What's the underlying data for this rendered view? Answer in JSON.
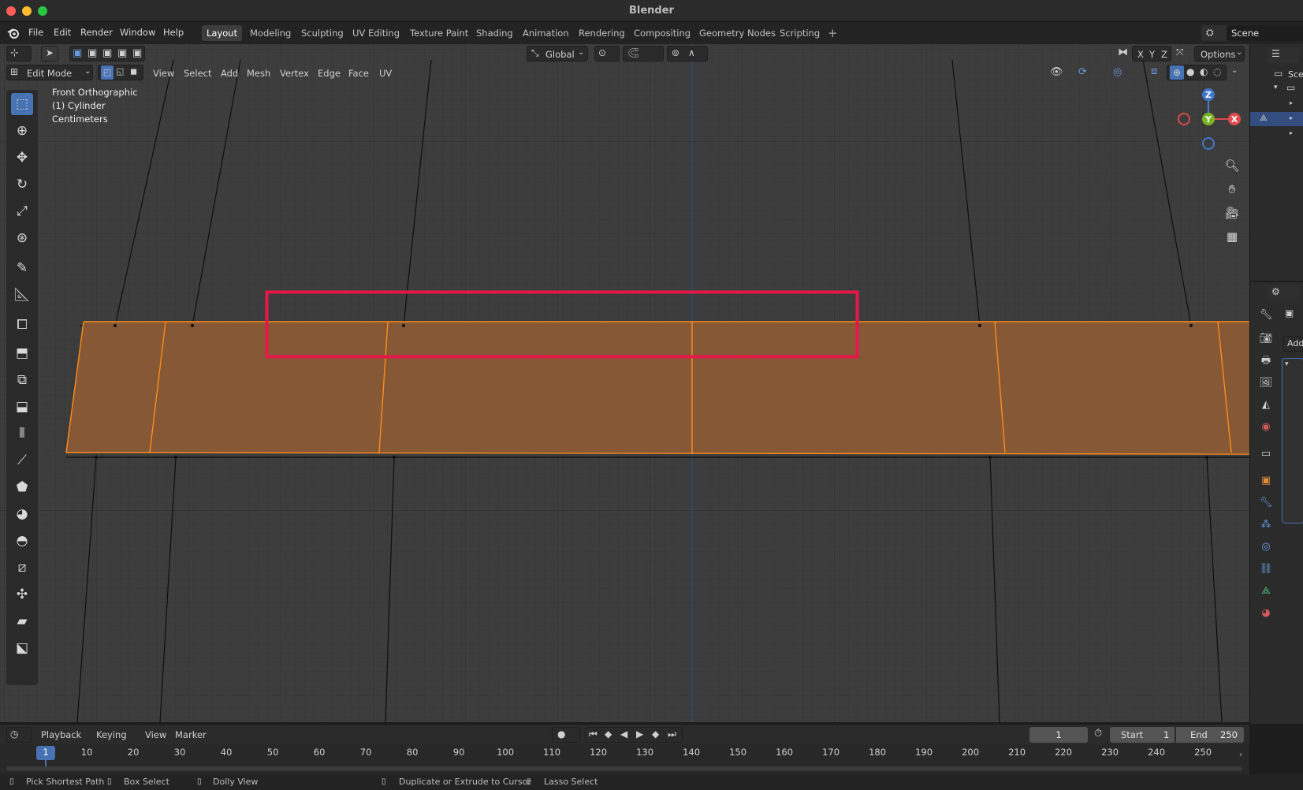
{
  "window": {
    "title": "Blender"
  },
  "menu": {
    "items": [
      "File",
      "Edit",
      "Render",
      "Window",
      "Help"
    ],
    "workspaces": [
      "Layout",
      "Modeling",
      "Sculpting",
      "UV Editing",
      "Texture Paint",
      "Shading",
      "Animation",
      "Rendering",
      "Compositing",
      "Geometry Nodes",
      "Scripting"
    ],
    "active_workspace": "Layout",
    "add_tab_icon": "plus-icon",
    "scene_label": "Scene"
  },
  "viewport_header": {
    "transform_orientation": "Global",
    "axes": [
      "X",
      "Y",
      "Z"
    ],
    "options_label": "Options",
    "mode": "Edit Mode",
    "menus": [
      "View",
      "Select",
      "Add",
      "Mesh",
      "Vertex",
      "Edge",
      "Face",
      "UV"
    ]
  },
  "viewport_overlay": {
    "view_name": "Front Orthographic",
    "object_name": "(1) Cylinder",
    "units": "Centimeters"
  },
  "gizmo": {
    "z": "Z",
    "y": "Y",
    "x": "X"
  },
  "highlight": {
    "color": "#e8174a"
  },
  "colors": {
    "selection": "#ff8c1a",
    "active_tool": "#4772b3",
    "viewport_bg": "#3d3d3d"
  },
  "toolbar": {
    "tools": [
      "select-box-icon",
      "cursor-icon",
      "move-icon",
      "rotate-icon",
      "scale-icon",
      "transform-icon",
      "annotate-icon",
      "measure-icon",
      "add-cube-icon",
      "extrude-icon",
      "inset-icon",
      "bevel-icon",
      "loop-cut-icon",
      "knife-icon",
      "poly-build-icon",
      "spin-icon",
      "smooth-icon",
      "edge-slide-icon",
      "shrink-fatten-icon",
      "shear-icon",
      "rip-icon"
    ]
  },
  "outliner": {
    "scene_label": "Scen"
  },
  "properties": {
    "add_label": "Add"
  },
  "timeline": {
    "menus": [
      "Playback",
      "Keying",
      "View",
      "Marker"
    ],
    "current_frame": "1",
    "start_label": "Start",
    "start_value": "1",
    "end_label": "End",
    "end_value": "250",
    "ticks": [
      "10",
      "20",
      "30",
      "40",
      "50",
      "60",
      "70",
      "80",
      "90",
      "100",
      "110",
      "120",
      "130",
      "140",
      "150",
      "160",
      "170",
      "180",
      "190",
      "200",
      "210",
      "220",
      "230",
      "240",
      "250"
    ],
    "playhead": "1"
  },
  "statusbar": {
    "items": [
      "Pick Shortest Path",
      "Box Select",
      "Dolly View",
      "Duplicate or Extrude to Cursor",
      "Lasso Select"
    ]
  }
}
